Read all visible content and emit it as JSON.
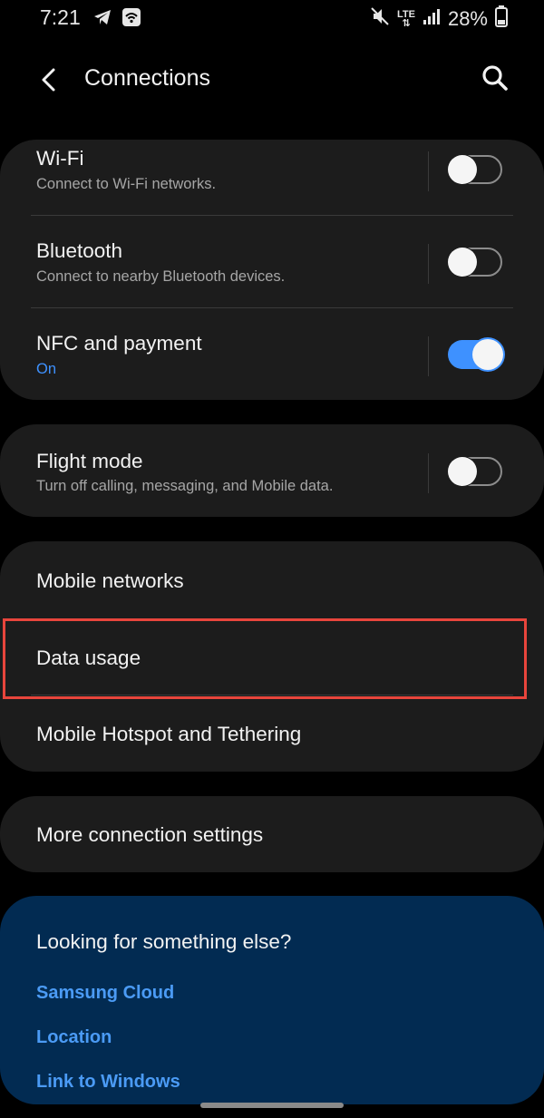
{
  "status_bar": {
    "time": "7:21",
    "network": "LTE",
    "battery": "28%"
  },
  "header": {
    "title": "Connections"
  },
  "connectivity": [
    {
      "title": "Wi-Fi",
      "subtitle": "Connect to Wi-Fi networks.",
      "toggle": "off"
    },
    {
      "title": "Bluetooth",
      "subtitle": "Connect to nearby Bluetooth devices.",
      "toggle": "off"
    },
    {
      "title": "NFC and payment",
      "subtitle": "On",
      "toggle": "on"
    }
  ],
  "flight": {
    "title": "Flight mode",
    "subtitle": "Turn off calling, messaging, and Mobile data.",
    "toggle": "off"
  },
  "network_items": [
    {
      "title": "Mobile networks"
    },
    {
      "title": "Data usage"
    },
    {
      "title": "Mobile Hotspot and Tethering"
    }
  ],
  "more": {
    "title": "More connection settings"
  },
  "suggestions": {
    "title": "Looking for something else?",
    "links": [
      "Samsung Cloud",
      "Location",
      "Link to Windows"
    ]
  },
  "colors": {
    "accent": "#3e91ff",
    "card": "#1c1c1c",
    "suggest_bg": "#022b52",
    "highlight": "#e8453c"
  }
}
